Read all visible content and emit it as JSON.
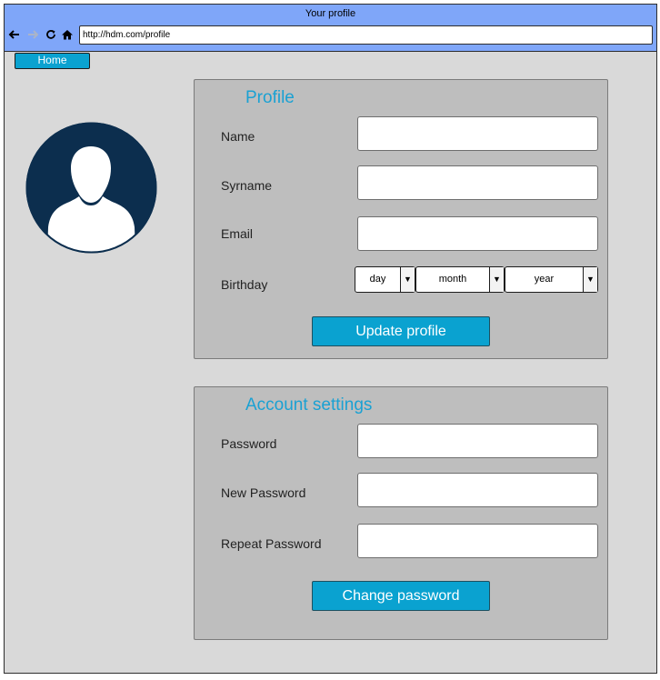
{
  "window": {
    "title": "Your profile",
    "url": "http://hdm.com/profile",
    "nav": {
      "back_icon": "arrow-left-icon",
      "forward_icon": "arrow-right-icon",
      "reload_icon": "reload-icon",
      "home_icon": "home-icon"
    }
  },
  "nav": {
    "home_label": "Home"
  },
  "avatar": {
    "icon": "user-avatar-icon",
    "color": "#0c2e4e"
  },
  "profile": {
    "title": "Profile",
    "fields": [
      {
        "label": "Name",
        "value": ""
      },
      {
        "label": "Syrname",
        "value": ""
      },
      {
        "label": "Email",
        "value": ""
      }
    ],
    "birthday": {
      "label": "Birthday",
      "day": "day",
      "month": "month",
      "year": "year"
    },
    "submit_label": "Update profile"
  },
  "account": {
    "title": "Account settings",
    "fields": [
      {
        "label": "Password",
        "value": ""
      },
      {
        "label": "New Password",
        "value": ""
      },
      {
        "label": "Repeat Password",
        "value": ""
      }
    ],
    "submit_label": "Change password"
  },
  "colors": {
    "titlebar": "#7fa6f9",
    "accent": "#0aa2d0",
    "panel_title": "#1aa1d3",
    "panel_bg": "#bebebe",
    "window_bg": "#d9d9d9"
  }
}
